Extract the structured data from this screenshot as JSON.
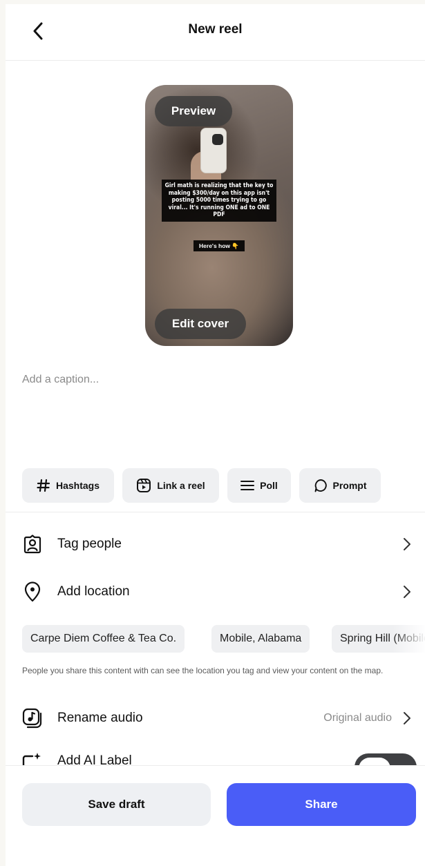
{
  "header": {
    "title": "New reel",
    "back_icon": "chevron-left-icon"
  },
  "preview": {
    "preview_label": "Preview",
    "edit_cover_label": "Edit cover",
    "overlay_text": "Girl math is realizing that the key to making $300/day on this app isn't posting 5000 times trying to go viral... It's running ONE ad to ONE PDF",
    "overlay_sub": "Here's how 👇"
  },
  "caption": {
    "placeholder": "Add a caption..."
  },
  "chips": [
    {
      "label": "Hashtags",
      "icon": "hash-icon"
    },
    {
      "label": "Link a reel",
      "icon": "reel-icon"
    },
    {
      "label": "Poll",
      "icon": "poll-icon"
    },
    {
      "label": "Prompt",
      "icon": "prompt-icon"
    }
  ],
  "rows": {
    "tag_people": {
      "label": "Tag people",
      "icon": "tag-person-icon"
    },
    "add_location": {
      "label": "Add location",
      "icon": "location-pin-icon"
    },
    "rename_audio": {
      "label": "Rename audio",
      "value": "Original audio",
      "icon": "music-note-icon"
    },
    "ai_label": {
      "label": "Add AI Label",
      "icon": "ai-sparkle-icon",
      "toggle_on": true
    }
  },
  "location_suggestions": [
    "Carpe Diem Coffee & Tea Co.",
    "Mobile, Alabama",
    "Spring Hill (Mobile)"
  ],
  "location_note": "People you share this content with can see the location you tag and view your content on the map.",
  "actions": {
    "save_draft": "Save draft",
    "share": "Share"
  },
  "colors": {
    "share_button": "#4a5df7",
    "chip_bg": "#eff0f2",
    "toggle_bg": "#3f4043"
  }
}
